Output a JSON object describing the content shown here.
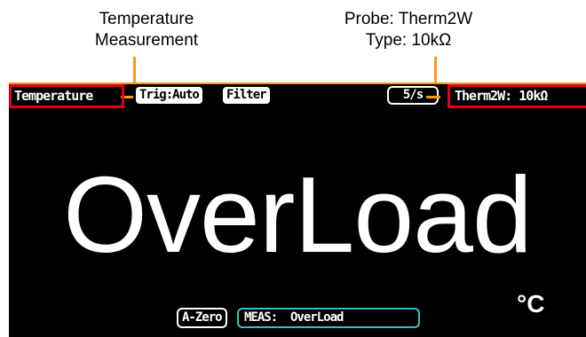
{
  "callouts": {
    "temperature": {
      "line1": "Temperature",
      "line2": "Measurement"
    },
    "probe": {
      "line1": "Probe: Therm2W",
      "line2": "Type: 10kΩ"
    }
  },
  "status_bar": {
    "function_label": "Temperature",
    "trigger_label": "Trig:Auto",
    "filter_label": "Filter",
    "rate_label": "5/s",
    "probe_label": "Therm2W: 10kΩ"
  },
  "display": {
    "reading": "OverLoad",
    "unit": "°C"
  },
  "bottom_bar": {
    "autozero_label": "A-Zero",
    "meas_label": "MEAS:  OverLoad"
  },
  "colors": {
    "callout_line": "#f39a1f",
    "highlight_box": "#e3001b",
    "screen_background": "#000000",
    "meas_border": "#2ec4c4"
  }
}
